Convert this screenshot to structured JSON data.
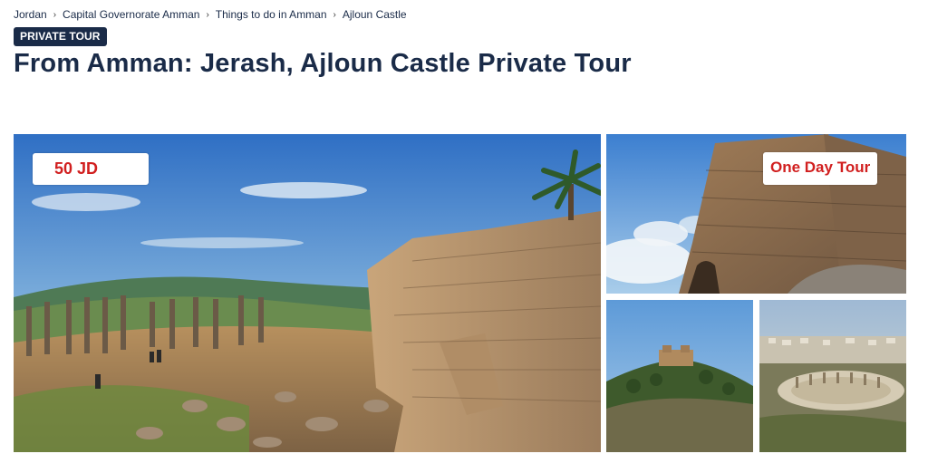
{
  "breadcrumb": [
    "Jordan",
    "Capital Governorate Amman",
    "Things to do in Amman",
    "Ajloun Castle"
  ],
  "badge": "PRIVATE TOUR",
  "title": "From Amman: Jerash, Ajloun Castle Private Tour",
  "gallery": {
    "main_overlay": "50 JD",
    "side_overlay": "One Day Tour"
  },
  "colors": {
    "navy": "#1a2b48",
    "overlay_text": "#d11f1f"
  }
}
